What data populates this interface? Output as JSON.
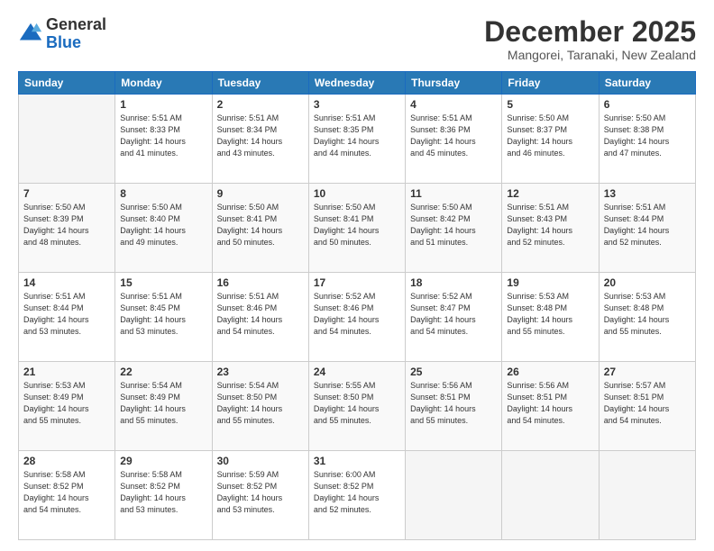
{
  "logo": {
    "general": "General",
    "blue": "Blue"
  },
  "header": {
    "month": "December 2025",
    "location": "Mangorei, Taranaki, New Zealand"
  },
  "weekdays": [
    "Sunday",
    "Monday",
    "Tuesday",
    "Wednesday",
    "Thursday",
    "Friday",
    "Saturday"
  ],
  "weeks": [
    [
      {
        "day": "",
        "sunrise": "",
        "sunset": "",
        "daylight": ""
      },
      {
        "day": "1",
        "sunrise": "5:51 AM",
        "sunset": "8:33 PM",
        "daylight": "14 hours and 41 minutes."
      },
      {
        "day": "2",
        "sunrise": "5:51 AM",
        "sunset": "8:34 PM",
        "daylight": "14 hours and 43 minutes."
      },
      {
        "day": "3",
        "sunrise": "5:51 AM",
        "sunset": "8:35 PM",
        "daylight": "14 hours and 44 minutes."
      },
      {
        "day": "4",
        "sunrise": "5:51 AM",
        "sunset": "8:36 PM",
        "daylight": "14 hours and 45 minutes."
      },
      {
        "day": "5",
        "sunrise": "5:50 AM",
        "sunset": "8:37 PM",
        "daylight": "14 hours and 46 minutes."
      },
      {
        "day": "6",
        "sunrise": "5:50 AM",
        "sunset": "8:38 PM",
        "daylight": "14 hours and 47 minutes."
      }
    ],
    [
      {
        "day": "7",
        "sunrise": "5:50 AM",
        "sunset": "8:39 PM",
        "daylight": "14 hours and 48 minutes."
      },
      {
        "day": "8",
        "sunrise": "5:50 AM",
        "sunset": "8:40 PM",
        "daylight": "14 hours and 49 minutes."
      },
      {
        "day": "9",
        "sunrise": "5:50 AM",
        "sunset": "8:41 PM",
        "daylight": "14 hours and 50 minutes."
      },
      {
        "day": "10",
        "sunrise": "5:50 AM",
        "sunset": "8:41 PM",
        "daylight": "14 hours and 50 minutes."
      },
      {
        "day": "11",
        "sunrise": "5:50 AM",
        "sunset": "8:42 PM",
        "daylight": "14 hours and 51 minutes."
      },
      {
        "day": "12",
        "sunrise": "5:51 AM",
        "sunset": "8:43 PM",
        "daylight": "14 hours and 52 minutes."
      },
      {
        "day": "13",
        "sunrise": "5:51 AM",
        "sunset": "8:44 PM",
        "daylight": "14 hours and 52 minutes."
      }
    ],
    [
      {
        "day": "14",
        "sunrise": "5:51 AM",
        "sunset": "8:44 PM",
        "daylight": "14 hours and 53 minutes."
      },
      {
        "day": "15",
        "sunrise": "5:51 AM",
        "sunset": "8:45 PM",
        "daylight": "14 hours and 53 minutes."
      },
      {
        "day": "16",
        "sunrise": "5:51 AM",
        "sunset": "8:46 PM",
        "daylight": "14 hours and 54 minutes."
      },
      {
        "day": "17",
        "sunrise": "5:52 AM",
        "sunset": "8:46 PM",
        "daylight": "14 hours and 54 minutes."
      },
      {
        "day": "18",
        "sunrise": "5:52 AM",
        "sunset": "8:47 PM",
        "daylight": "14 hours and 54 minutes."
      },
      {
        "day": "19",
        "sunrise": "5:53 AM",
        "sunset": "8:48 PM",
        "daylight": "14 hours and 55 minutes."
      },
      {
        "day": "20",
        "sunrise": "5:53 AM",
        "sunset": "8:48 PM",
        "daylight": "14 hours and 55 minutes."
      }
    ],
    [
      {
        "day": "21",
        "sunrise": "5:53 AM",
        "sunset": "8:49 PM",
        "daylight": "14 hours and 55 minutes."
      },
      {
        "day": "22",
        "sunrise": "5:54 AM",
        "sunset": "8:49 PM",
        "daylight": "14 hours and 55 minutes."
      },
      {
        "day": "23",
        "sunrise": "5:54 AM",
        "sunset": "8:50 PM",
        "daylight": "14 hours and 55 minutes."
      },
      {
        "day": "24",
        "sunrise": "5:55 AM",
        "sunset": "8:50 PM",
        "daylight": "14 hours and 55 minutes."
      },
      {
        "day": "25",
        "sunrise": "5:56 AM",
        "sunset": "8:51 PM",
        "daylight": "14 hours and 55 minutes."
      },
      {
        "day": "26",
        "sunrise": "5:56 AM",
        "sunset": "8:51 PM",
        "daylight": "14 hours and 54 minutes."
      },
      {
        "day": "27",
        "sunrise": "5:57 AM",
        "sunset": "8:51 PM",
        "daylight": "14 hours and 54 minutes."
      }
    ],
    [
      {
        "day": "28",
        "sunrise": "5:58 AM",
        "sunset": "8:52 PM",
        "daylight": "14 hours and 54 minutes."
      },
      {
        "day": "29",
        "sunrise": "5:58 AM",
        "sunset": "8:52 PM",
        "daylight": "14 hours and 53 minutes."
      },
      {
        "day": "30",
        "sunrise": "5:59 AM",
        "sunset": "8:52 PM",
        "daylight": "14 hours and 53 minutes."
      },
      {
        "day": "31",
        "sunrise": "6:00 AM",
        "sunset": "8:52 PM",
        "daylight": "14 hours and 52 minutes."
      },
      {
        "day": "",
        "sunrise": "",
        "sunset": "",
        "daylight": ""
      },
      {
        "day": "",
        "sunrise": "",
        "sunset": "",
        "daylight": ""
      },
      {
        "day": "",
        "sunrise": "",
        "sunset": "",
        "daylight": ""
      }
    ]
  ]
}
